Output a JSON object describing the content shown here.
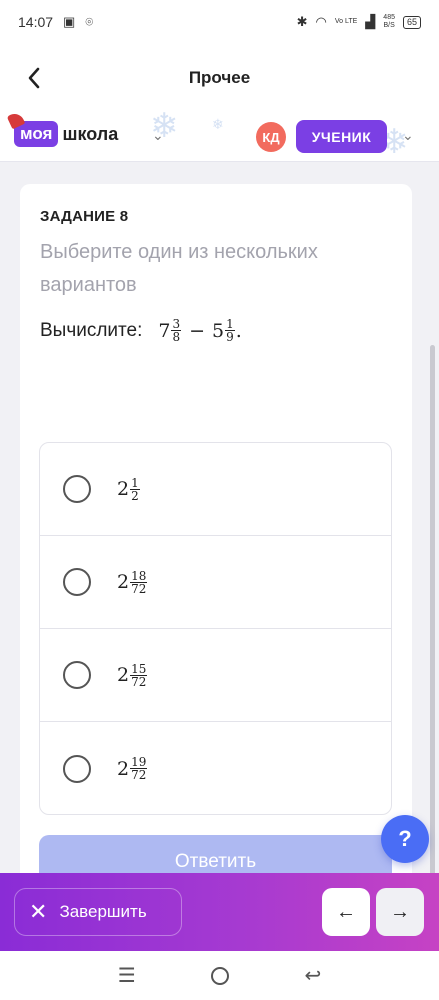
{
  "status_bar": {
    "time": "14:07",
    "signal_label": "Vo LTE",
    "speed_value": "485",
    "speed_unit": "B/S",
    "battery": "65"
  },
  "header": {
    "title": "Прочее"
  },
  "brand": {
    "logo_part1": "моя",
    "logo_part2": "школа",
    "avatar_initials": "КД",
    "role_label": "УЧЕНИК"
  },
  "task": {
    "label": "ЗАДАНИЕ 8",
    "instruction": "Выберите один из нескольких вариантов",
    "question_label": "Вычислите:",
    "expression": {
      "a_whole": "7",
      "a_num": "3",
      "a_den": "8",
      "operator": "−",
      "b_whole": "5",
      "b_num": "1",
      "b_den": "9",
      "end": "."
    }
  },
  "options": [
    {
      "whole": "2",
      "num": "1",
      "den": "2"
    },
    {
      "whole": "2",
      "num": "18",
      "den": "72"
    },
    {
      "whole": "2",
      "num": "15",
      "den": "72"
    },
    {
      "whole": "2",
      "num": "19",
      "den": "72"
    }
  ],
  "answer_button": "Ответить",
  "help_button": "?",
  "bottom_bar": {
    "finish_label": "Завершить"
  },
  "colors": {
    "brand_purple": "#7b3fe4",
    "answer_disabled": "#aeb9f2",
    "help_blue": "#4a6df5",
    "bar_gradient_start": "#8a2cd6",
    "bar_gradient_end": "#c642c4"
  }
}
